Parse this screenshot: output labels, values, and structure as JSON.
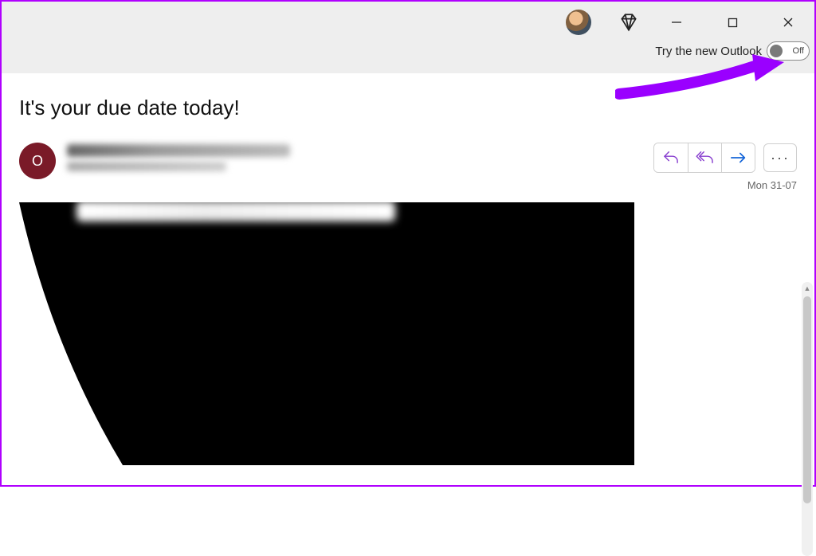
{
  "header": {
    "try_label": "Try the new Outlook",
    "toggle_state": "Off"
  },
  "message": {
    "subject": "It's your due date today!",
    "sender_initial": "O",
    "date": "Mon 31-07"
  },
  "actions": {
    "more_label": "···"
  },
  "icons": {
    "reply_color": "#883fcf",
    "forward_color": "#1565d8"
  }
}
